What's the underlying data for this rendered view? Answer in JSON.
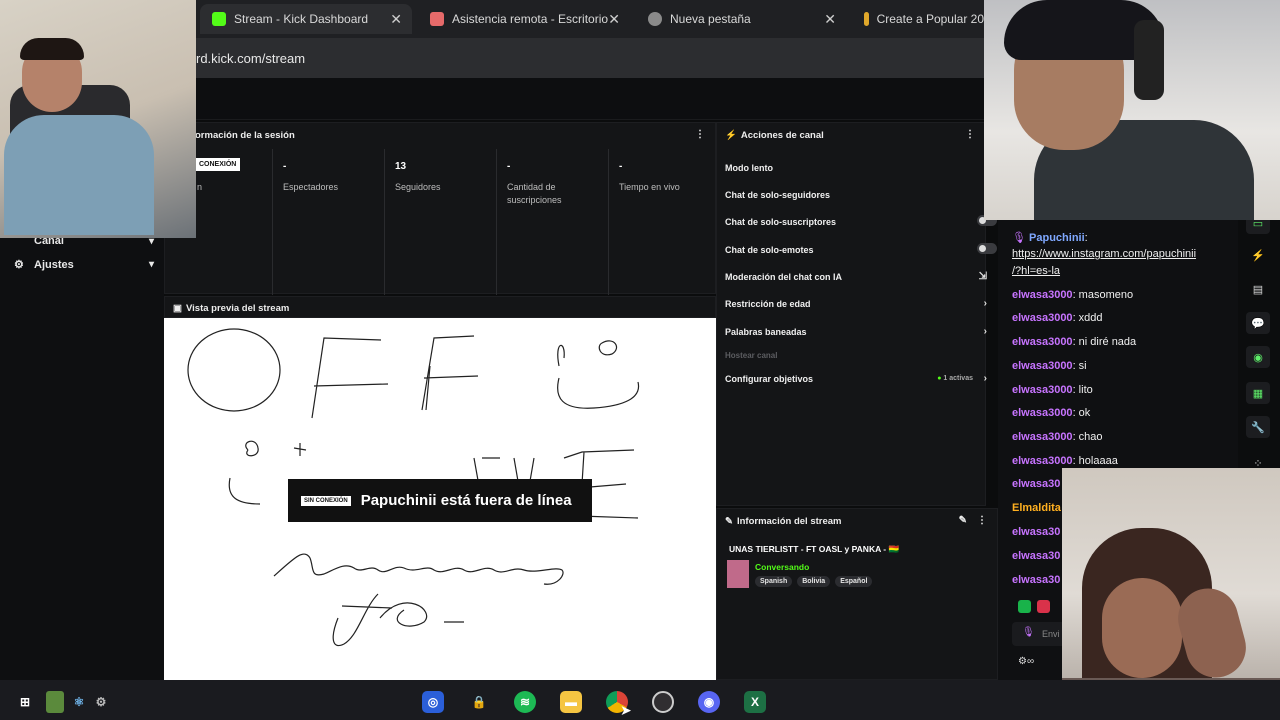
{
  "browser": {
    "tabs": [
      {
        "title": "Stream - Kick Dashboard",
        "active": true
      },
      {
        "title": "Asistencia remota - Escritorio",
        "active": false
      },
      {
        "title": "Nueva pestaña",
        "active": false
      },
      {
        "title": "Create a Popular 20",
        "active": false
      }
    ],
    "url": "rd.kick.com/stream"
  },
  "sidebar": {
    "items": [
      {
        "label": "Canal"
      },
      {
        "label": "Ajustes"
      }
    ]
  },
  "session": {
    "title": "ormación de la sesión",
    "status_badge": "CONEXIÓN",
    "status_label": "n",
    "stats": [
      {
        "value": "-",
        "label": "Espectadores"
      },
      {
        "value": "13",
        "label": "Seguidores"
      },
      {
        "value": "-",
        "label": "Cantidad de suscripciones"
      },
      {
        "value": "-",
        "label": "Tiempo en vivo"
      }
    ]
  },
  "actions": {
    "title": "Acciones de canal",
    "items": [
      {
        "label": "Modo lento"
      },
      {
        "label": "Chat de solo-seguidores"
      },
      {
        "label": "Chat de solo-suscriptores"
      },
      {
        "label": "Chat de solo-emotes"
      },
      {
        "label": "Moderación del chat con IA"
      },
      {
        "label": "Restricción de edad"
      },
      {
        "label": "Palabras baneadas"
      },
      {
        "label": "Hostear canal"
      },
      {
        "label": "Configurar objetivos"
      }
    ],
    "goals_active": "1 activas"
  },
  "preview": {
    "title": "Vista previa del stream",
    "offline_badge": "SIN CONEXIÓN",
    "offline_text": "Papuchinii está fuera de línea"
  },
  "stream_info": {
    "title": "Información del stream",
    "stream_title": "UNAS TIERLISTT - FT OASL y PANKA - 🇧🇴",
    "category": "Conversando",
    "tags": [
      "Spanish",
      "Bolivia",
      "Español"
    ]
  },
  "chat": {
    "messages": [
      {
        "user": "Papuchinii",
        "text": ":"
      },
      {
        "user": "",
        "text": "https://www.instagram.com/papuchinii"
      },
      {
        "user": "",
        "text": "/?hl=es-la"
      },
      {
        "user": "elwasa3000",
        "text": ": masomeno"
      },
      {
        "user": "elwasa3000",
        "text": ": xddd"
      },
      {
        "user": "elwasa3000",
        "text": ": ni diré nada"
      },
      {
        "user": "elwasa3000",
        "text": ": si"
      },
      {
        "user": "elwasa3000",
        "text": ": lito"
      },
      {
        "user": "elwasa3000",
        "text": ": ok"
      },
      {
        "user": "elwasa3000",
        "text": ": chao"
      },
      {
        "user": "elwasa3000",
        "text": ": holaaaa"
      },
      {
        "user": "elwasa30",
        "text": ""
      },
      {
        "user": "Elmaldita",
        "text": ""
      },
      {
        "user": "elwasa30",
        "text": ""
      },
      {
        "user": "elwasa30",
        "text": ""
      },
      {
        "user": "elwasa30",
        "text": ""
      }
    ],
    "send_label": "Envi"
  },
  "colors": {
    "kick_green": "#53fc18",
    "chat_user": "#c774ff",
    "chat_user_alt": "#ffb020"
  }
}
